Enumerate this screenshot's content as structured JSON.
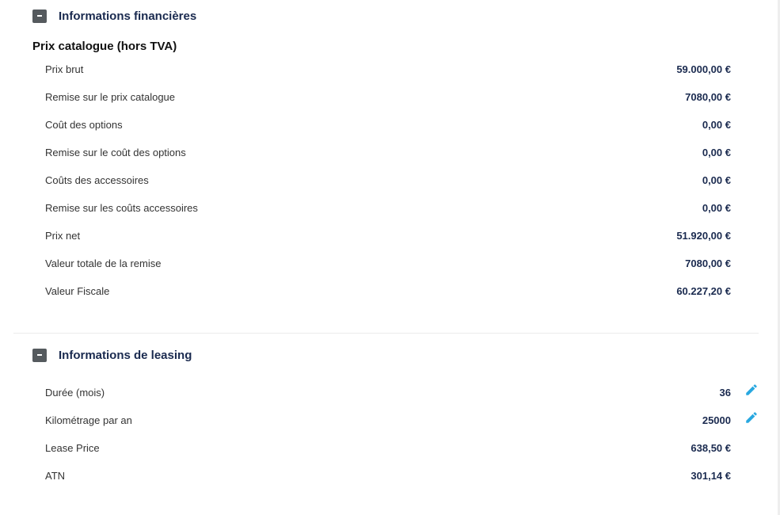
{
  "financial": {
    "title": "Informations financières",
    "subtitle": "Prix catalogue (hors TVA)",
    "rows": [
      {
        "label": "Prix brut",
        "value": "59.000,00 €"
      },
      {
        "label": "Remise sur le prix catalogue",
        "value": "7080,00 €"
      },
      {
        "label": "Coût des options",
        "value": "0,00 €"
      },
      {
        "label": "Remise sur le coût des options",
        "value": "0,00 €"
      },
      {
        "label": "Coûts des accessoires",
        "value": "0,00 €"
      },
      {
        "label": "Remise sur les coûts accessoires",
        "value": "0,00 €"
      },
      {
        "label": "Prix net",
        "value": "51.920,00 €"
      },
      {
        "label": "Valeur totale de la remise",
        "value": "7080,00 €"
      },
      {
        "label": "Valeur Fiscale",
        "value": "60.227,20 €"
      }
    ]
  },
  "leasing": {
    "title": "Informations de leasing",
    "rows": [
      {
        "label": "Durée (mois)",
        "value": "36"
      },
      {
        "label": "Kilométrage par an",
        "value": "25000"
      },
      {
        "label": "Lease Price",
        "value": "638,50 €"
      },
      {
        "label": "ATN",
        "value": "301,14 €"
      }
    ]
  },
  "icons": {
    "collapse": "minus-square-icon",
    "edit": "pencil-icon"
  },
  "colors": {
    "heading": "#1a2a4f",
    "edit_icon": "#29a8e0",
    "collapse_button": "#555a5e"
  }
}
